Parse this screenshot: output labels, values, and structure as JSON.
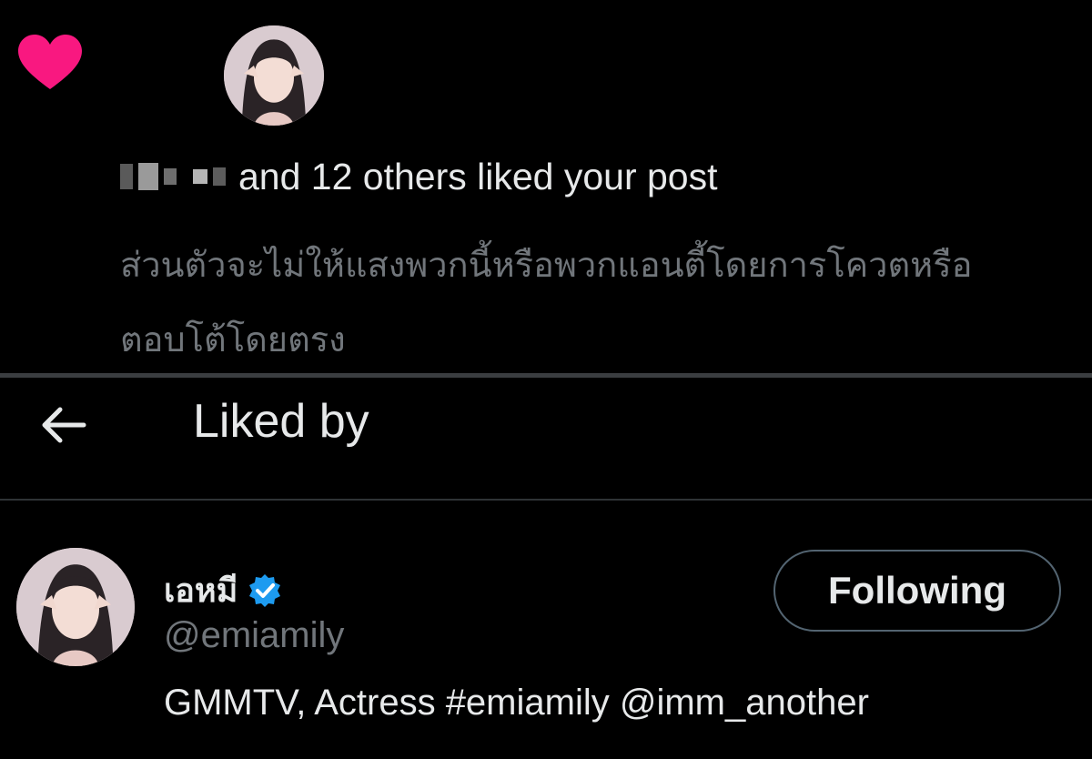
{
  "notification": {
    "icon": "heart-icon",
    "like_color": "#f91880",
    "liked_text": "and 12 others liked your post",
    "post_text": "ส่วนตัวจะไม่ให้แสงพวกนี้หรือพวกแอนตี้โดยการโควตหรือตอบโต้โดยตรง"
  },
  "header": {
    "back_icon": "arrow-left-icon",
    "title": "Liked by"
  },
  "user": {
    "display_name": "เอหมี",
    "verified_icon": "verified-badge-icon",
    "verified_color": "#1d9bf0",
    "handle": "@emiamily",
    "bio": "GMMTV, Actress #emiamily @imm_another",
    "follow_button_label": "Following"
  }
}
